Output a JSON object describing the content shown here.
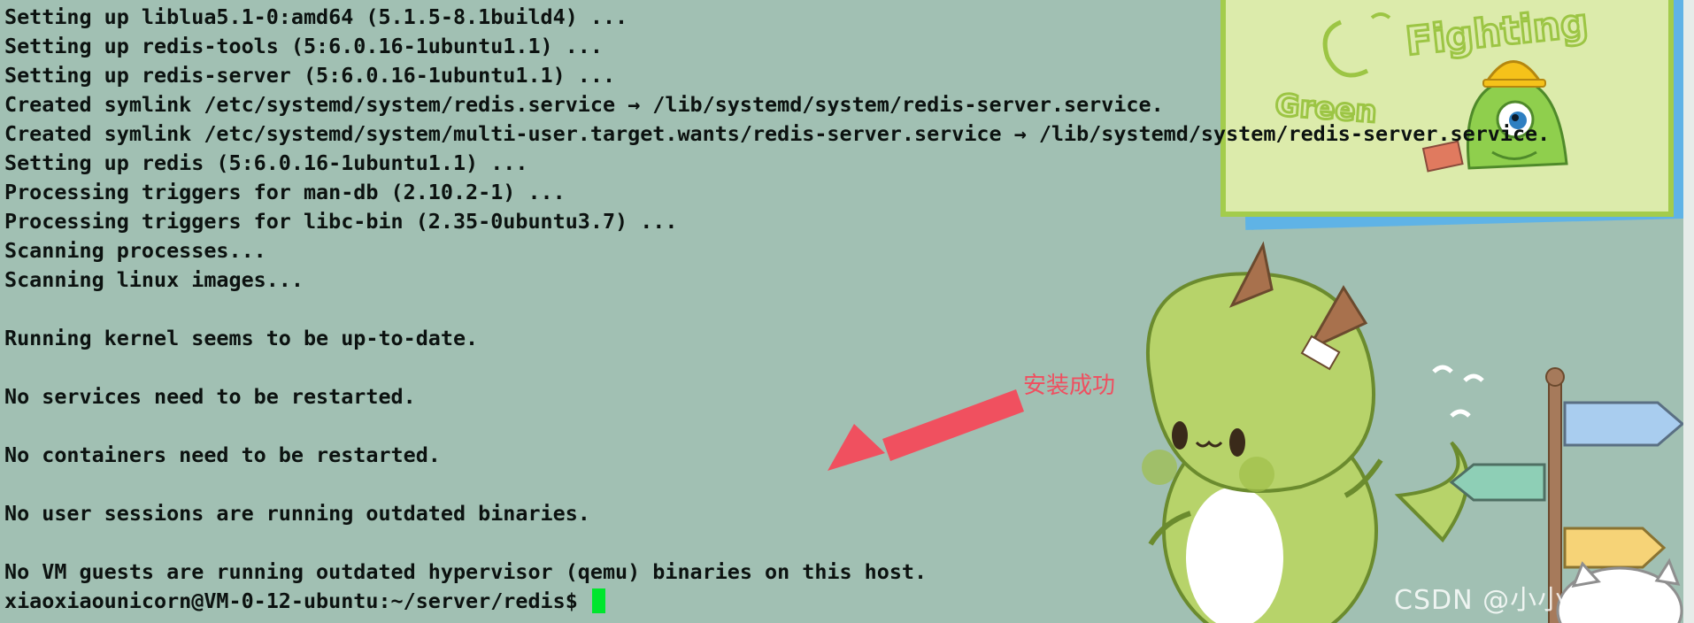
{
  "terminal": {
    "lines": [
      "Setting up liblua5.1-0:amd64 (5.1.5-8.1build4) ...",
      "Setting up redis-tools (5:6.0.16-1ubuntu1.1) ...",
      "Setting up redis-server (5:6.0.16-1ubuntu1.1) ...",
      "Created symlink /etc/systemd/system/redis.service → /lib/systemd/system/redis-server.service.",
      "Created symlink /etc/systemd/system/multi-user.target.wants/redis-server.service → /lib/systemd/system/redis-server.service.",
      "Setting up redis (5:6.0.16-1ubuntu1.1) ...",
      "Processing triggers for man-db (2.10.2-1) ...",
      "Processing triggers for libc-bin (2.35-0ubuntu3.7) ...",
      "Scanning processes...",
      "Scanning linux images...",
      "",
      "Running kernel seems to be up-to-date.",
      "",
      "No services need to be restarted.",
      "",
      "No containers need to be restarted.",
      "",
      "No user sessions are running outdated binaries.",
      "",
      "No VM guests are running outdated hypervisor (qemu) binaries on this host."
    ],
    "prompt": "xiaoxiaounicorn@VM-0-12-ubuntu:~/server/redis$ ",
    "cursor_color": "#00e62d",
    "background_color": "#a1c0b3"
  },
  "annotation": {
    "text": "安装成功",
    "color": "#ef4f60"
  },
  "wallpaper": {
    "sticker_word_1": "Fighting",
    "sticker_word_2": "Green"
  },
  "watermark": {
    "text": "CSDN @小小unicorn"
  }
}
